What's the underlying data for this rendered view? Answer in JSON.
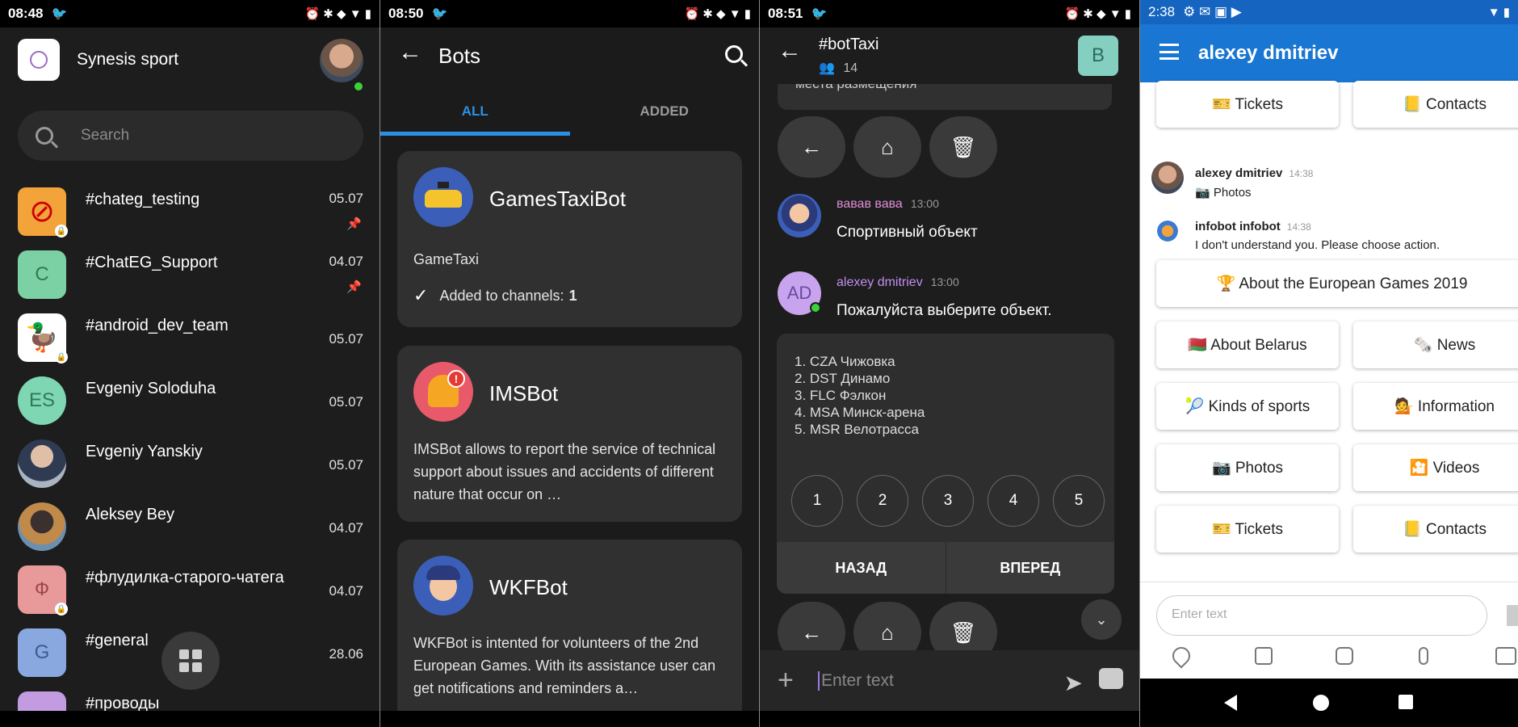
{
  "screen1": {
    "status": {
      "time": "08:48"
    },
    "org_name": "Synesis sport",
    "search_placeholder": "Search",
    "chats": [
      {
        "name": "#chateg_testing",
        "date": "05.07",
        "pinned": true,
        "avatar_color": "#f2a33a",
        "initial": ""
      },
      {
        "name": "#ChatEG_Support",
        "date": "04.07",
        "pinned": true,
        "avatar_color": "#7bd0a4",
        "initial": "C"
      },
      {
        "name": "#android_dev_team",
        "date": "05.07",
        "pinned": false,
        "avatar_color": "#ffffff",
        "initial": ""
      },
      {
        "name": "Evgeniy Soloduha",
        "date": "05.07",
        "pinned": false,
        "avatar_color": "#7ed6b3",
        "initial": "ES"
      },
      {
        "name": "Evgeniy Yanskiy",
        "date": "05.07",
        "pinned": false,
        "avatar_color": "#7a8a9a",
        "initial": ""
      },
      {
        "name": "Aleksey Bey",
        "date": "04.07",
        "pinned": false,
        "avatar_color": "#c08a4a",
        "initial": ""
      },
      {
        "name": "#флудилка-старого-чатега",
        "date": "04.07",
        "pinned": false,
        "avatar_color": "#e89a9a",
        "initial": "Ф"
      },
      {
        "name": "#general",
        "date": "28.06",
        "pinned": false,
        "avatar_color": "#8aa8e0",
        "initial": "G"
      },
      {
        "name": "#проводы",
        "date": "",
        "pinned": false,
        "avatar_color": "#c39be0",
        "initial": ""
      }
    ]
  },
  "screen2": {
    "status": {
      "time": "08:50"
    },
    "title": "Bots",
    "tabs": [
      "ALL",
      "ADDED"
    ],
    "bots": [
      {
        "name": "GamesTaxiBot",
        "desc": "GameTaxi",
        "added_label": "Added to channels:",
        "added_count": "1"
      },
      {
        "name": "IMSBot",
        "desc": "IMSBot allows to report the service of technical support about issues and accidents of different nature that occur on …"
      },
      {
        "name": "WKFBot",
        "desc": "WKFBot is intented for volunteers of the 2nd European Games. With its assistance user can get notifications and reminders a…"
      }
    ]
  },
  "screen3": {
    "status": {
      "time": "08:51"
    },
    "title": "#botTaxi",
    "members": "14",
    "channel_initial": "B",
    "top_hint": "места размещения",
    "messages": [
      {
        "author": "вавав вава",
        "time": "13:00",
        "text": "Спортивный объект"
      },
      {
        "author": "alexey dmitriev",
        "time": "13:00",
        "text": "Пожалуйста выберите объект.",
        "initials": "AD"
      }
    ],
    "options": [
      "1. CZA Чижовка",
      "2. DST Динамо",
      "3. FLC Фэлкон",
      "4. MSA Минск-арена",
      "5. MSR Велотрасса"
    ],
    "numbers": [
      "1",
      "2",
      "3",
      "4",
      "5"
    ],
    "nav": {
      "back": "НАЗАД",
      "forward": "ВПЕРЕД"
    },
    "input_placeholder": "Enter text"
  },
  "screen4": {
    "status": {
      "time": "2:38"
    },
    "title": "alexey dmitriev",
    "top_buttons": [
      "🎫 Tickets",
      "📒 Contacts"
    ],
    "messages": [
      {
        "author": "alexey dmitriev",
        "time": "14:38",
        "text": "📷 Photos"
      },
      {
        "author": "infobot infobot",
        "time": "14:38",
        "text": "I don't understand you. Please choose action."
      }
    ],
    "wide_button": "🏆 About the European Games 2019",
    "buttons": [
      [
        "🇧🇾 About Belarus",
        "🗞️ News"
      ],
      [
        "🎾 Kinds of sports",
        "💁 Information"
      ],
      [
        "📷 Photos",
        "🎦 Videos"
      ],
      [
        "🎫 Tickets",
        "📒 Contacts"
      ]
    ],
    "input_placeholder": "Enter text"
  }
}
